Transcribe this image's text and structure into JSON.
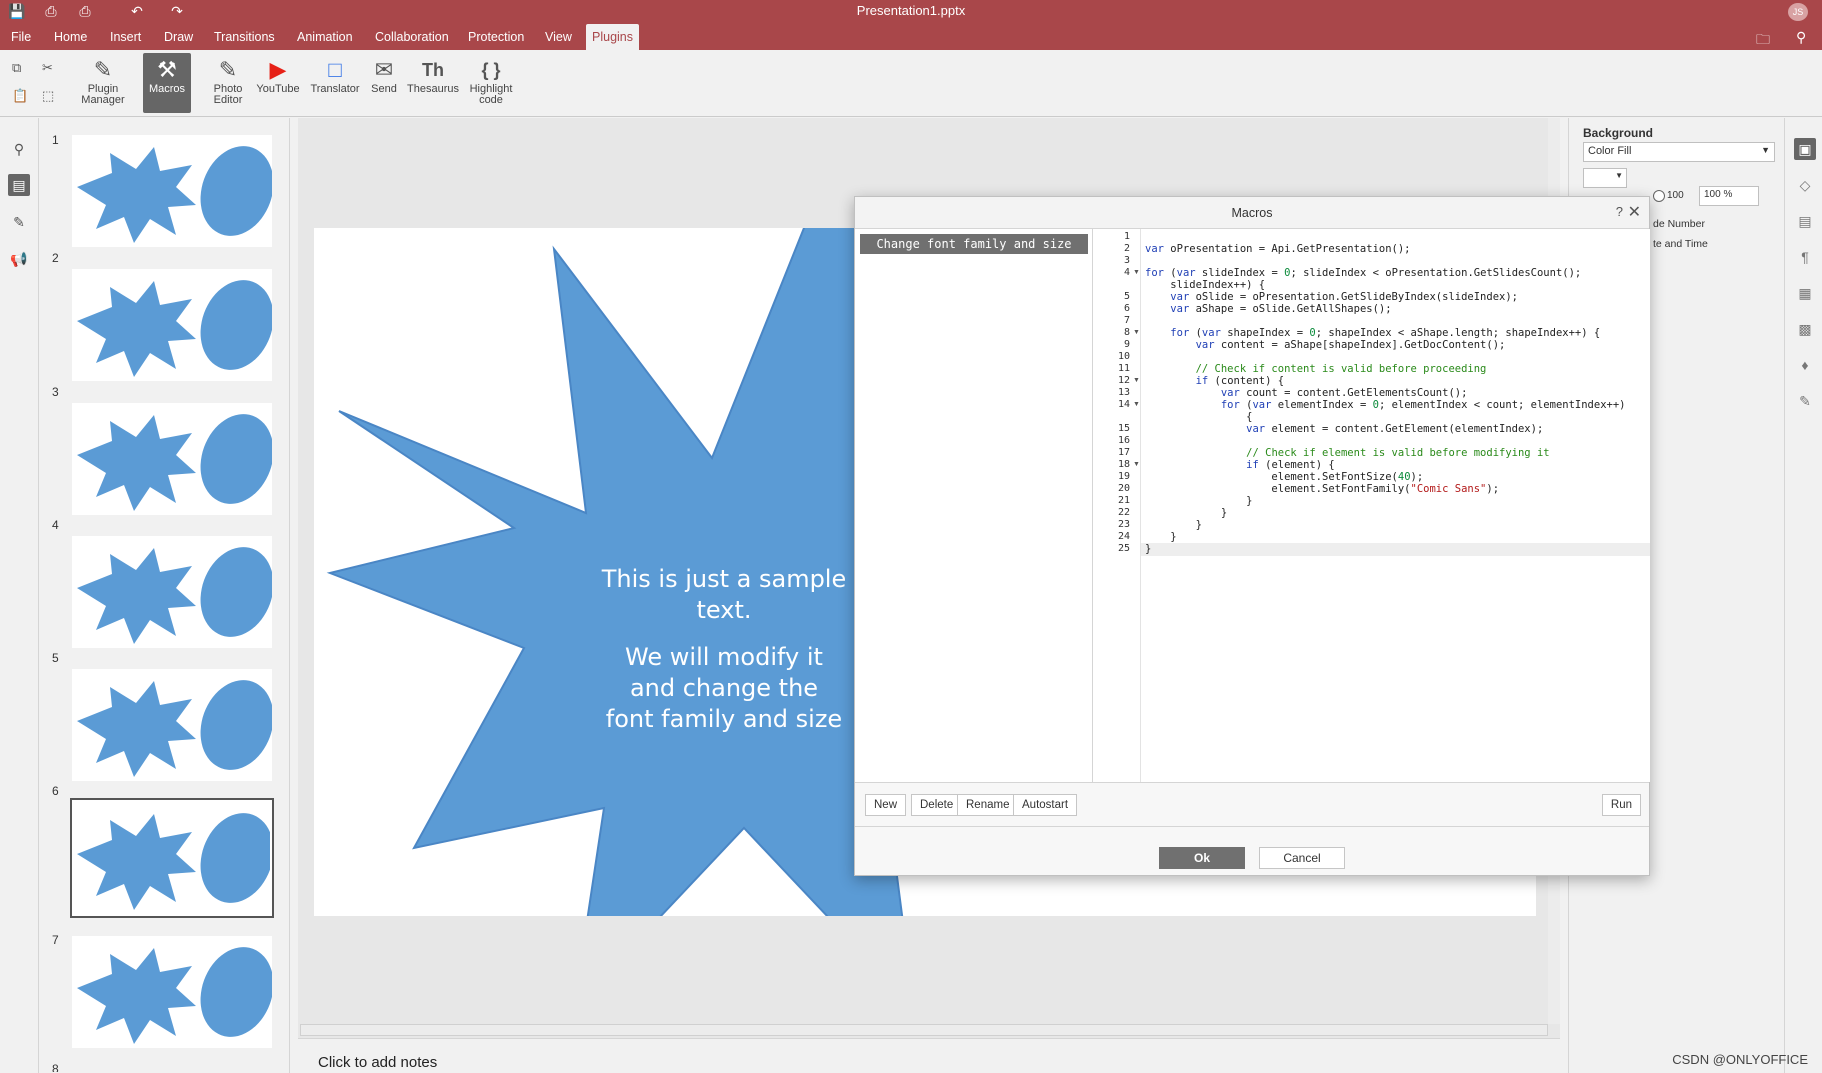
{
  "app": {
    "document_title": "Presentation1.pptx",
    "avatar_initials": "JS",
    "accent_color": "#a9474a"
  },
  "menu": {
    "tabs": [
      "File",
      "Home",
      "Insert",
      "Draw",
      "Transitions",
      "Animation",
      "Collaboration",
      "Protection",
      "View",
      "Plugins"
    ],
    "active_tab": "Plugins"
  },
  "ribbon": {
    "plugin_manager": "Plugin Manager",
    "macros": "Macros",
    "photo_editor": "Photo Editor",
    "youtube": "YouTube",
    "translator": "Translator",
    "send": "Send",
    "thesaurus": "Thesaurus",
    "highlight_code": "Highlight code",
    "thesaurus_glyph": "Th",
    "highlight_glyph": "{ }"
  },
  "slides": {
    "numbers": [
      "1",
      "2",
      "3",
      "4",
      "5",
      "6",
      "7",
      "8"
    ],
    "selected": "6"
  },
  "slide": {
    "text_line1": "This is just a sample",
    "text_line2": "text.",
    "text_line3": "We will modify it",
    "text_line4": "and change the",
    "text_line5": "font family and size"
  },
  "notes": {
    "placeholder": "Click to add notes"
  },
  "right_panel": {
    "background_label": "Background",
    "fill_select": "Color Fill",
    "opacity_value": "100",
    "opacity_percent": "100 %",
    "slide_number_partial": "de Number",
    "date_time_partial": "te and Time"
  },
  "dialog": {
    "title": "Macros",
    "help": "?",
    "macro_name": "Change font family and size",
    "buttons": {
      "new": "New",
      "delete": "Delete",
      "rename": "Rename",
      "autostart": "Autostart",
      "run": "Run"
    },
    "ok": "Ok",
    "cancel": "Cancel",
    "line_numbers": [
      "1",
      "2",
      "3",
      "4",
      "",
      "5",
      "6",
      "7",
      "8",
      "9",
      "10",
      "11",
      "12",
      "13",
      "14",
      "",
      "15",
      "16",
      "17",
      "18",
      "19",
      "20",
      "21",
      "22",
      "23",
      "24",
      "25"
    ]
  },
  "watermark": "CSDN @ONLYOFFICE"
}
